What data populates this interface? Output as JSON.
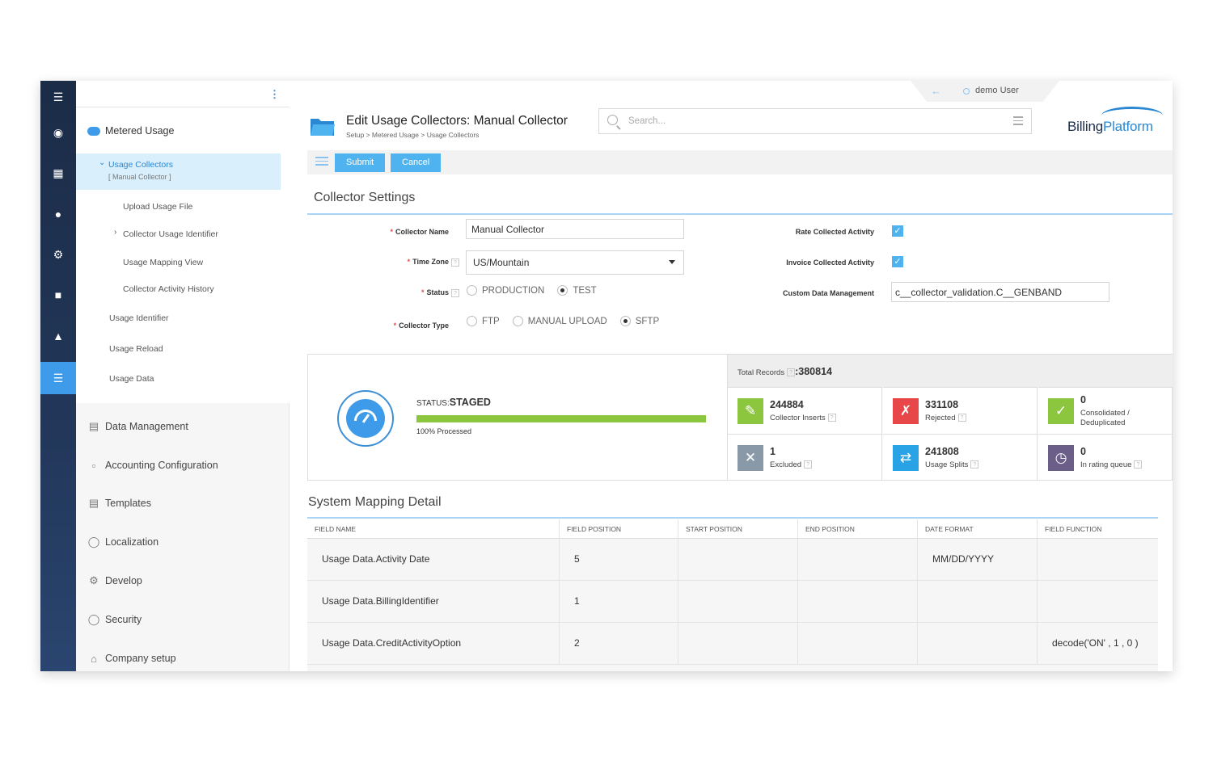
{
  "user": {
    "name": "demo User"
  },
  "header": {
    "title": "Edit Usage Collectors: Manual Collector",
    "breadcrumb": "Setup > Metered Usage > Usage Collectors",
    "search_placeholder": "Search...",
    "logo_text_1": "Billing",
    "logo_text_2": "Platform"
  },
  "toolbar": {
    "submit_label": "Submit",
    "cancel_label": "Cancel"
  },
  "sidebar": {
    "heading": "Metered Usage",
    "active_item": "Usage Collectors",
    "active_sub": "[ Manual Collector ]",
    "sub_items": [
      "Upload Usage File",
      "Collector Usage Identifier",
      "Usage Mapping View",
      "Collector Activity History"
    ],
    "items": [
      "Usage Identifier",
      "Usage Reload",
      "Usage Data"
    ],
    "sections": [
      "Data Management",
      "Accounting Configuration",
      "Templates",
      "Localization",
      "Develop",
      "Security",
      "Company setup"
    ]
  },
  "collector_settings": {
    "title": "Collector Settings",
    "collector_name_label": "Collector Name",
    "collector_name_value": "Manual Collector",
    "time_zone_label": "Time Zone",
    "time_zone_value": "US/Mountain",
    "status_label": "Status",
    "status_options": [
      "PRODUCTION",
      "TEST"
    ],
    "status_selected": "TEST",
    "collector_type_label": "Collector Type",
    "collector_type_options": [
      "FTP",
      "MANUAL UPLOAD",
      "SFTP"
    ],
    "collector_type_selected": "SFTP",
    "rate_label": "Rate Collected Activity",
    "rate_checked": true,
    "invoice_label": "Invoice Collected Activity",
    "invoice_checked": true,
    "custom_data_label": "Custom Data Management",
    "custom_data_value": "c__collector_validation.C__GENBAND"
  },
  "processing": {
    "status_prefix": "STATUS:",
    "status_value": "STAGED",
    "progress_percent": 100,
    "progress_label": "100% Processed"
  },
  "stats": {
    "total_label": "Total Records",
    "total_value": ":380814",
    "cells": [
      {
        "value": "244884",
        "label": "Collector Inserts",
        "color": "#8cc63f",
        "icon": "document-edit-icon"
      },
      {
        "value": "331108",
        "label": "Rejected",
        "color": "#e8474a",
        "icon": "document-reject-icon"
      },
      {
        "value": "0",
        "label": "Consolidated / Deduplicated",
        "color": "#8cc63f",
        "icon": "checkmark-icon"
      },
      {
        "value": "1",
        "label": "Excluded",
        "color": "#8a99a8",
        "icon": "excluded-icon"
      },
      {
        "value": "241808",
        "label": "Usage Splits",
        "color": "#2aa3e6",
        "icon": "split-icon"
      },
      {
        "value": "0",
        "label": "In rating queue",
        "color": "#6b5f8a",
        "icon": "clock-icon"
      }
    ]
  },
  "mapping": {
    "title": "System Mapping Detail",
    "columns": [
      "FIELD NAME",
      "FIELD POSITION",
      "START POSITION",
      "END POSITION",
      "DATE FORMAT",
      "FIELD FUNCTION"
    ],
    "rows": [
      [
        "Usage Data.Activity Date",
        "5",
        "",
        "",
        "MM/DD/YYYY",
        ""
      ],
      [
        "Usage Data.BillingIdentifier",
        "1",
        "",
        "",
        "",
        ""
      ],
      [
        "Usage Data.CreditActivityOption",
        "2",
        "",
        "",
        "",
        "decode('ON' , 1 , 0 )"
      ]
    ]
  },
  "colors": {
    "accent": "#3d9be9",
    "rail": "#1b2c47",
    "success": "#8cc63f"
  }
}
